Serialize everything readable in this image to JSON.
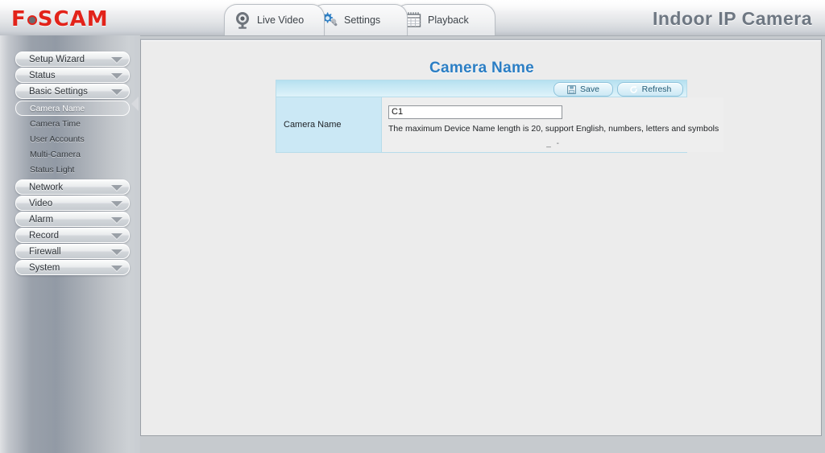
{
  "header": {
    "logo_text": "F@SCAM",
    "logo_parts": {
      "pre": "F",
      "post": "SCAM"
    },
    "brand": "Indoor IP Camera",
    "tabs": [
      {
        "label": "Live Video",
        "icon": "webcam-icon"
      },
      {
        "label": "Settings",
        "icon": "gear-wrench-icon"
      },
      {
        "label": "Playback",
        "icon": "calendar-icon"
      }
    ]
  },
  "sidebar": {
    "groups": [
      {
        "label": "Setup Wizard",
        "icon": "chevron-down-icon",
        "items": []
      },
      {
        "label": "Status",
        "icon": "chevron-down-icon",
        "items": []
      },
      {
        "label": "Basic Settings",
        "icon": "chevron-down-icon",
        "items": [
          {
            "label": "Camera Name",
            "active": true
          },
          {
            "label": "Camera Time",
            "active": false
          },
          {
            "label": "User Accounts",
            "active": false
          },
          {
            "label": "Multi-Camera",
            "active": false
          },
          {
            "label": "Status Light",
            "active": false
          }
        ]
      },
      {
        "label": "Network",
        "icon": "chevron-down-icon",
        "items": []
      },
      {
        "label": "Video",
        "icon": "chevron-down-icon",
        "items": []
      },
      {
        "label": "Alarm",
        "icon": "chevron-down-icon",
        "items": []
      },
      {
        "label": "Record",
        "icon": "chevron-down-icon",
        "items": []
      },
      {
        "label": "Firewall",
        "icon": "chevron-down-icon",
        "items": []
      },
      {
        "label": "System",
        "icon": "chevron-down-icon",
        "items": []
      }
    ]
  },
  "main": {
    "page_title": "Camera Name",
    "toolbar": {
      "save_label": "Save",
      "save_icon": "floppy-disk-icon",
      "refresh_label": "Refresh",
      "refresh_icon": "refresh-arrow-icon"
    },
    "form": {
      "row_label": "Camera Name",
      "input_value": "C1",
      "input_placeholder": "",
      "hint": "The maximum Device Name length is 20, support English, numbers, letters and symbols",
      "artifact": "_ -"
    }
  },
  "colors": {
    "accent_blue": "#2b7ec4",
    "brand_red": "#e2231a",
    "panel_blue": "#cbe8f5",
    "content_bg": "#ececec"
  }
}
